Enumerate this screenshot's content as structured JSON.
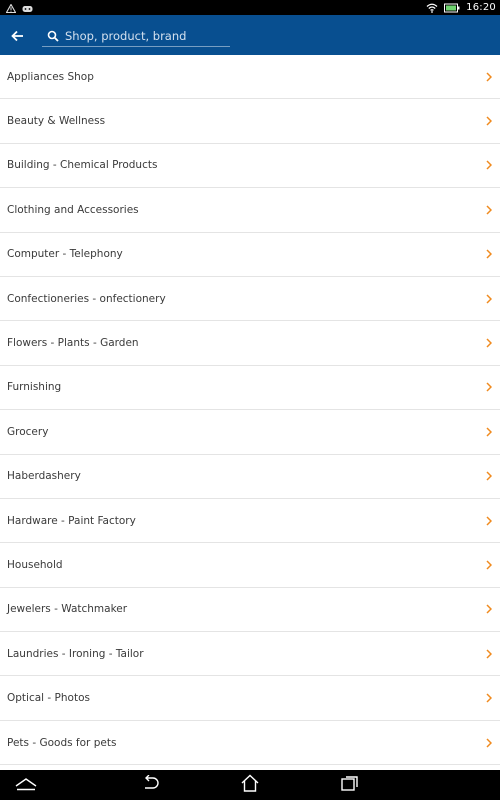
{
  "status_bar": {
    "time": "16:20",
    "icons": [
      "warning-icon",
      "notification-icon",
      "wifi-icon",
      "battery-icon"
    ]
  },
  "header": {
    "search_placeholder": "Shop, product, brand",
    "back_icon": "arrow-left-icon",
    "search_icon": "search-icon"
  },
  "categories": [
    {
      "label": "Appliances Shop"
    },
    {
      "label": "Beauty & Wellness"
    },
    {
      "label": "Building - Chemical Products"
    },
    {
      "label": "Clothing and Accessories"
    },
    {
      "label": "Computer - Telephony"
    },
    {
      "label": "Confectioneries - onfectionery"
    },
    {
      "label": "Flowers - Plants - Garden"
    },
    {
      "label": "Furnishing"
    },
    {
      "label": "Grocery"
    },
    {
      "label": "Haberdashery"
    },
    {
      "label": "Hardware - Paint Factory"
    },
    {
      "label": "Household"
    },
    {
      "label": "Jewelers - Watchmaker"
    },
    {
      "label": "Laundries - Ironing - Tailor"
    },
    {
      "label": "Optical - Photos"
    },
    {
      "label": "Pets - Goods for pets"
    }
  ],
  "nav_bar": {
    "icons": [
      "up-chevron-icon",
      "back-icon",
      "home-icon",
      "recent-apps-icon"
    ]
  },
  "colors": {
    "app_bar": "#084f90",
    "chevron": "#f08a1e",
    "text": "#3a3a3a",
    "divider": "#e4e4e4"
  }
}
